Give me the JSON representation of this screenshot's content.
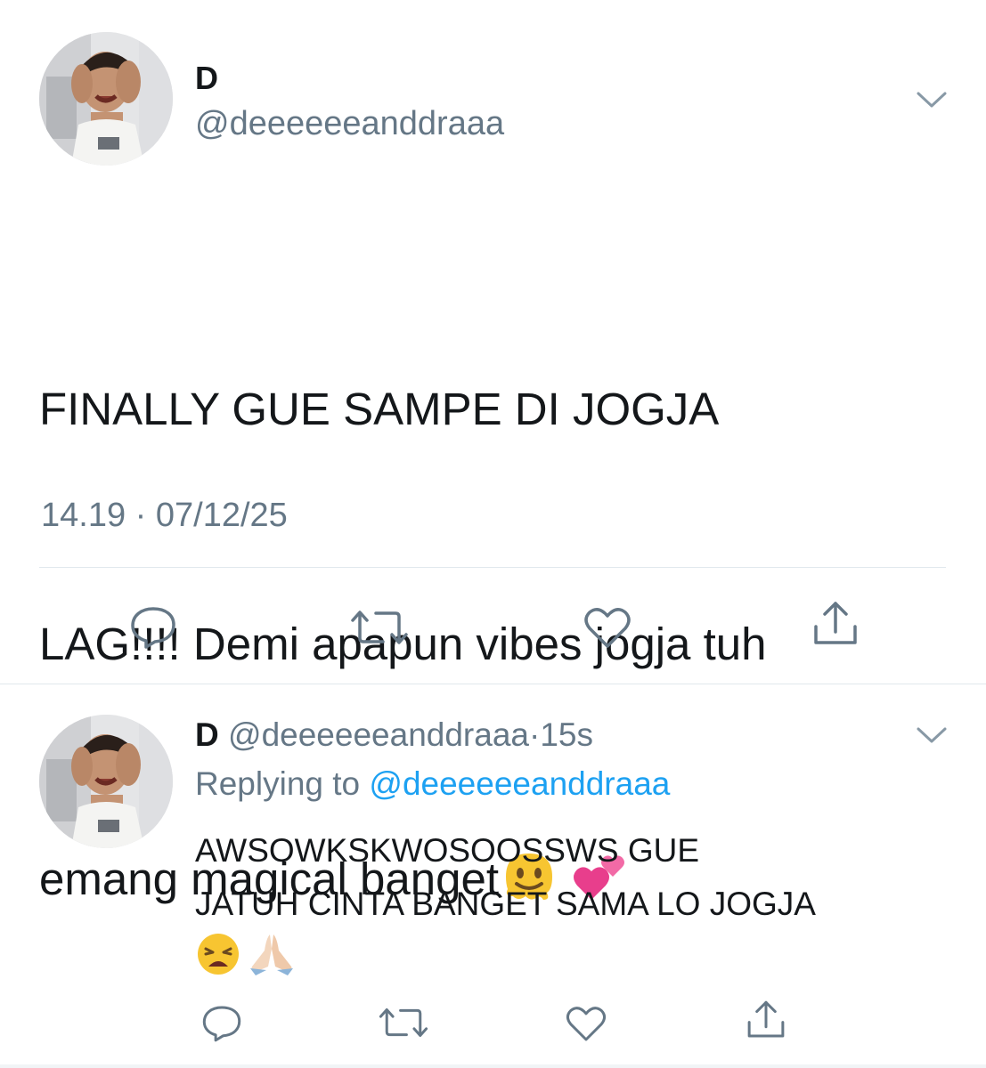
{
  "main_tweet": {
    "author_name": "D",
    "author_handle": "@deeeeeeanddraaa",
    "text_lines": [
      "FINALLY GUE SAMPE DI JOGJA",
      "LAG!!!! Demi apapun vibes jogja tuh",
      "emang magical banget"
    ],
    "emojis": [
      "melting-face-emoji",
      "two-hearts-emoji"
    ],
    "timestamp": "14.19 · 07/12/25",
    "actions": [
      "reply-icon",
      "retweet-icon",
      "like-icon",
      "share-icon"
    ]
  },
  "reply_tweet": {
    "author_name": "D",
    "author_handle": "@deeeeeeanddraaa",
    "separator": "·",
    "time_ago": "15s",
    "replying_label": "Replying to",
    "replying_handle": "@deeeeeeanddraaa",
    "text_lines": [
      "AWSOWKSKWOSOOSSWS GUE",
      "JATUH CINTA BANGET SAMA LO  JOGJA"
    ],
    "emojis": [
      "weary-face-emoji",
      "folded-hands-emoji"
    ],
    "actions": [
      "reply-icon",
      "retweet-icon",
      "like-icon",
      "share-icon"
    ]
  },
  "colors": {
    "primary_text": "#14171a",
    "secondary_text": "#657786",
    "link": "#1da1f2",
    "divider": "#e1e8ed"
  }
}
